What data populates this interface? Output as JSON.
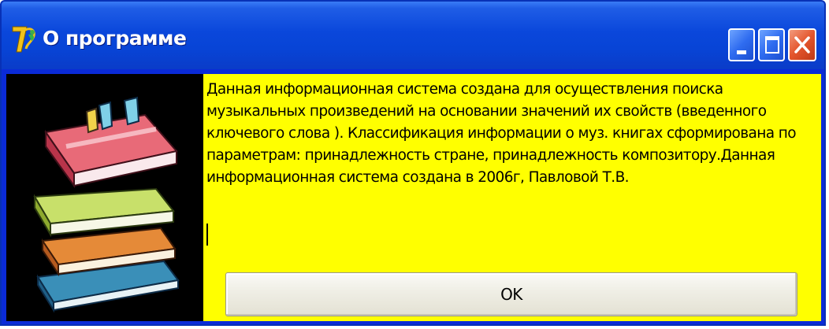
{
  "window": {
    "title": "О программе",
    "app_icon": "delphi-app-icon",
    "controls": {
      "minimize_icon": "minimize-icon",
      "maximize_icon": "maximize-icon",
      "close_icon": "close-icon"
    }
  },
  "content": {
    "picture_icon": "books-stack-icon",
    "message": "Данная информационная система создана для осуществления поиска\nмузыкальных произведений на основании значений их свойств (введенного\nключевого слова ). Классификация информации о муз. книгах сформирована по\nпараметрам: принадлежность стране, принадлежность композитору.Данная\nинформационная система  создана в 2006г, Павловой Т.В.",
    "ok_label": "OK"
  },
  "colors": {
    "titlebar": "#0a47db",
    "client_background": "#ffff00",
    "picture_background": "#000000",
    "close_button": "#e4552c"
  }
}
